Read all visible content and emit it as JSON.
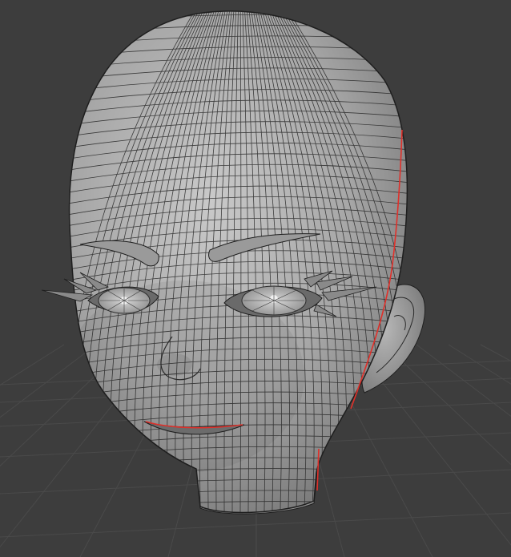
{
  "viewport": {
    "kind": "3d-viewport",
    "background_color": "#3d3d3d",
    "grid_color": "#4a4a4a",
    "mesh": {
      "object": "head",
      "shading": "solid-gray-wireframe",
      "base_color": "#9c9c9c",
      "wire_color": "#1f1f1f",
      "seam_color": "#e0302a"
    }
  }
}
